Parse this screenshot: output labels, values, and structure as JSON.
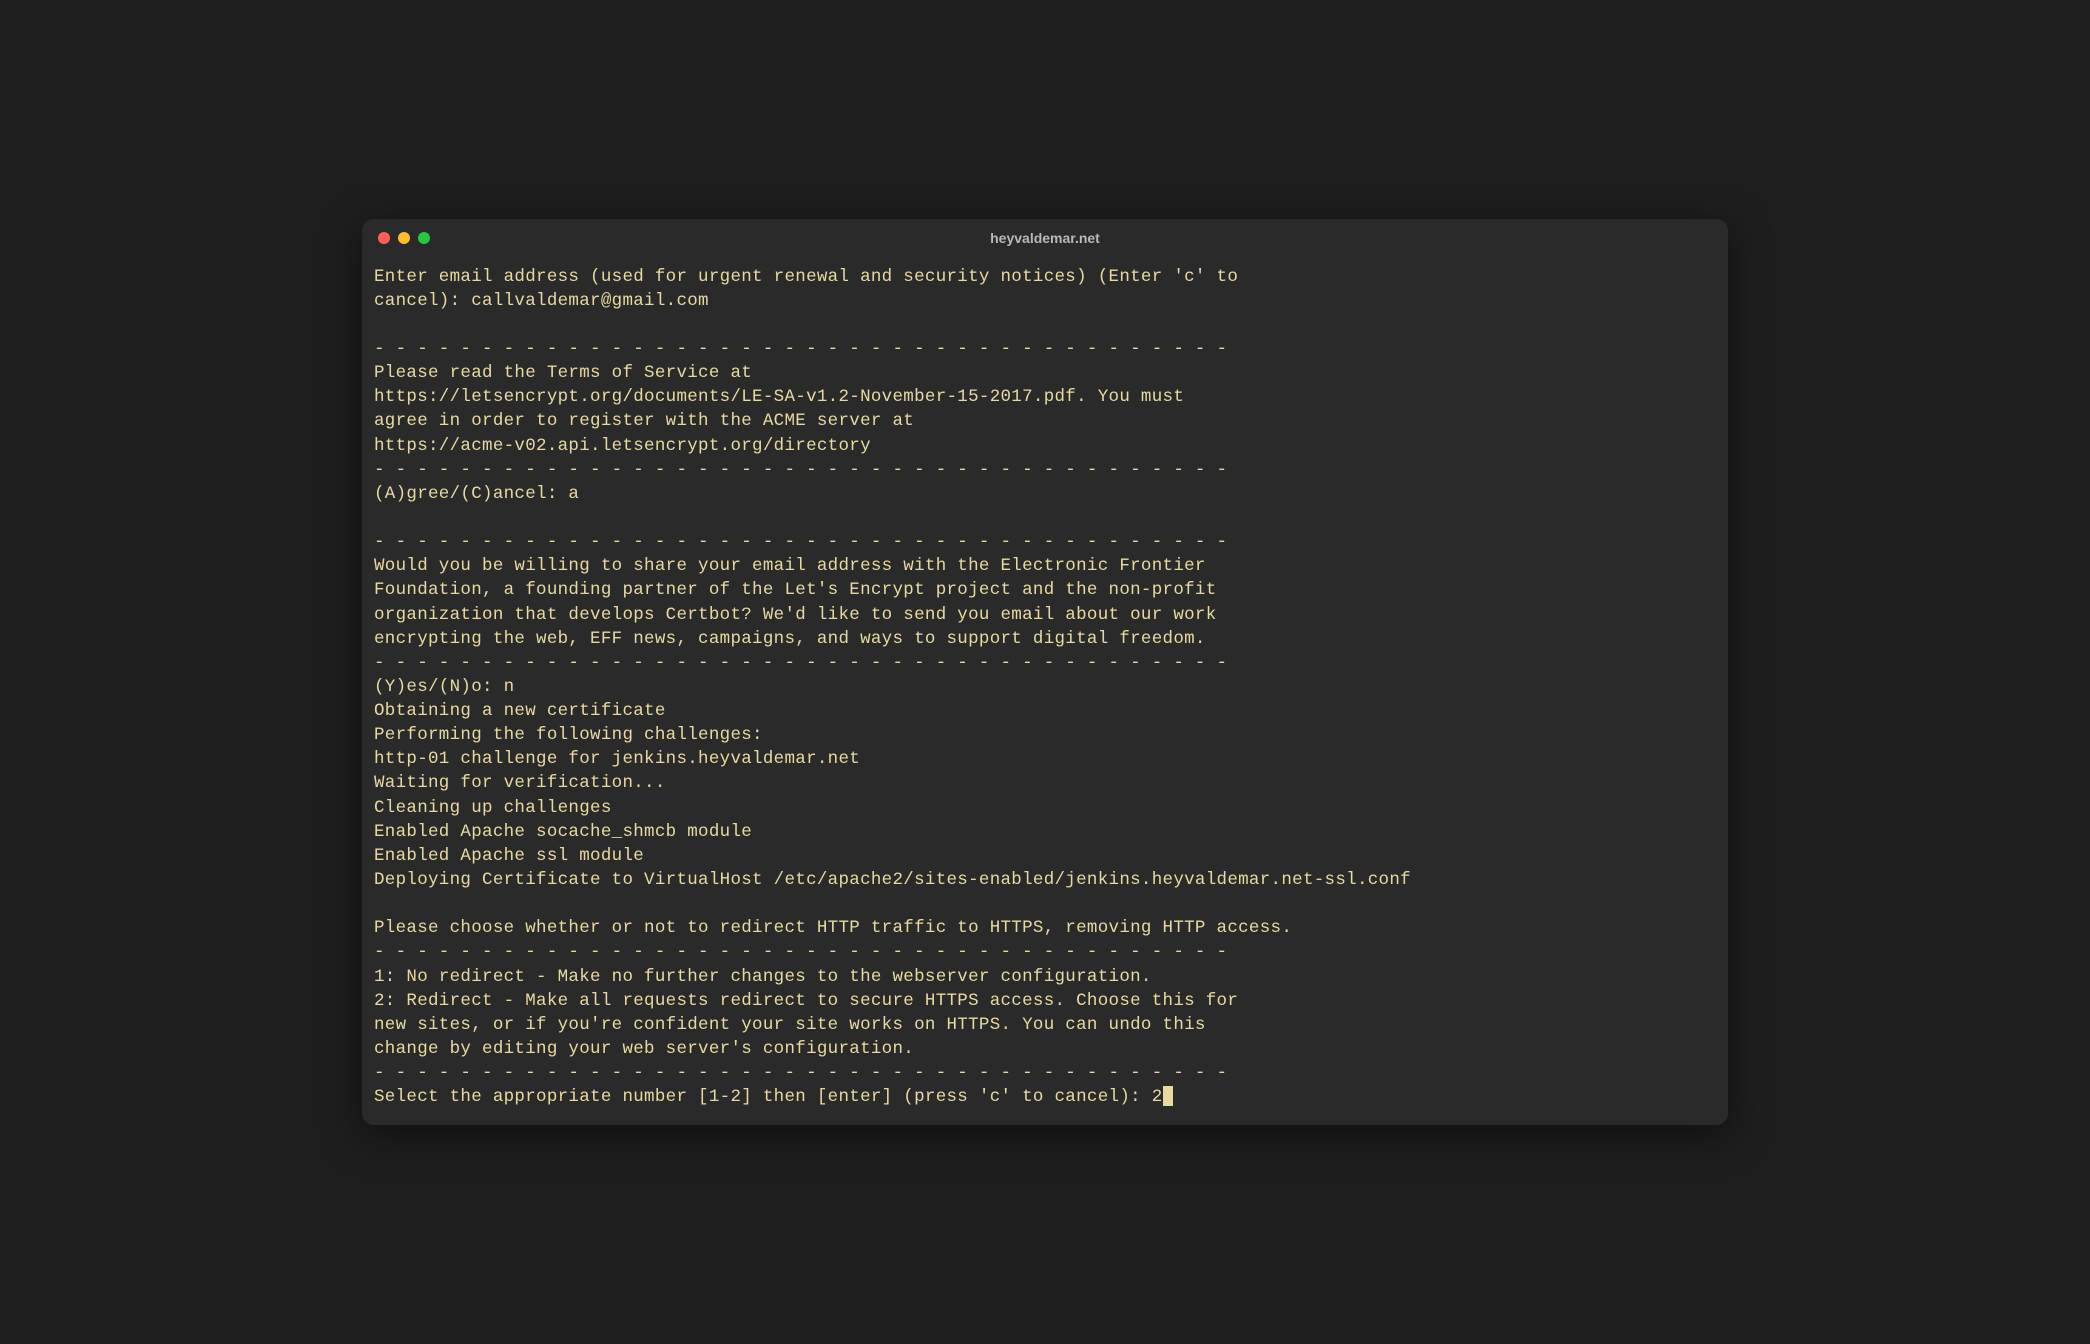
{
  "window": {
    "title": "heyvaldemar.net"
  },
  "terminal": {
    "lines": [
      "Enter email address (used for urgent renewal and security notices) (Enter 'c' to",
      "cancel): callvaldemar@gmail.com",
      "",
      "- - - - - - - - - - - - - - - - - - - - - - - - - - - - - - - - - - - - - - - -",
      "Please read the Terms of Service at",
      "https://letsencrypt.org/documents/LE-SA-v1.2-November-15-2017.pdf. You must",
      "agree in order to register with the ACME server at",
      "https://acme-v02.api.letsencrypt.org/directory",
      "- - - - - - - - - - - - - - - - - - - - - - - - - - - - - - - - - - - - - - - -",
      "(A)gree/(C)ancel: a",
      "",
      "- - - - - - - - - - - - - - - - - - - - - - - - - - - - - - - - - - - - - - - -",
      "Would you be willing to share your email address with the Electronic Frontier",
      "Foundation, a founding partner of the Let's Encrypt project and the non-profit",
      "organization that develops Certbot? We'd like to send you email about our work",
      "encrypting the web, EFF news, campaigns, and ways to support digital freedom.",
      "- - - - - - - - - - - - - - - - - - - - - - - - - - - - - - - - - - - - - - - -",
      "(Y)es/(N)o: n",
      "Obtaining a new certificate",
      "Performing the following challenges:",
      "http-01 challenge for jenkins.heyvaldemar.net",
      "Waiting for verification...",
      "Cleaning up challenges",
      "Enabled Apache socache_shmcb module",
      "Enabled Apache ssl module",
      "Deploying Certificate to VirtualHost /etc/apache2/sites-enabled/jenkins.heyvaldemar.net-ssl.conf",
      "",
      "Please choose whether or not to redirect HTTP traffic to HTTPS, removing HTTP access.",
      "- - - - - - - - - - - - - - - - - - - - - - - - - - - - - - - - - - - - - - - -",
      "1: No redirect - Make no further changes to the webserver configuration.",
      "2: Redirect - Make all requests redirect to secure HTTPS access. Choose this for",
      "new sites, or if you're confident your site works on HTTPS. You can undo this",
      "change by editing your web server's configuration.",
      "- - - - - - - - - - - - - - - - - - - - - - - - - - - - - - - - - - - - - - - -"
    ],
    "prompt_line": "Select the appropriate number [1-2] then [enter] (press 'c' to cancel): 2"
  }
}
